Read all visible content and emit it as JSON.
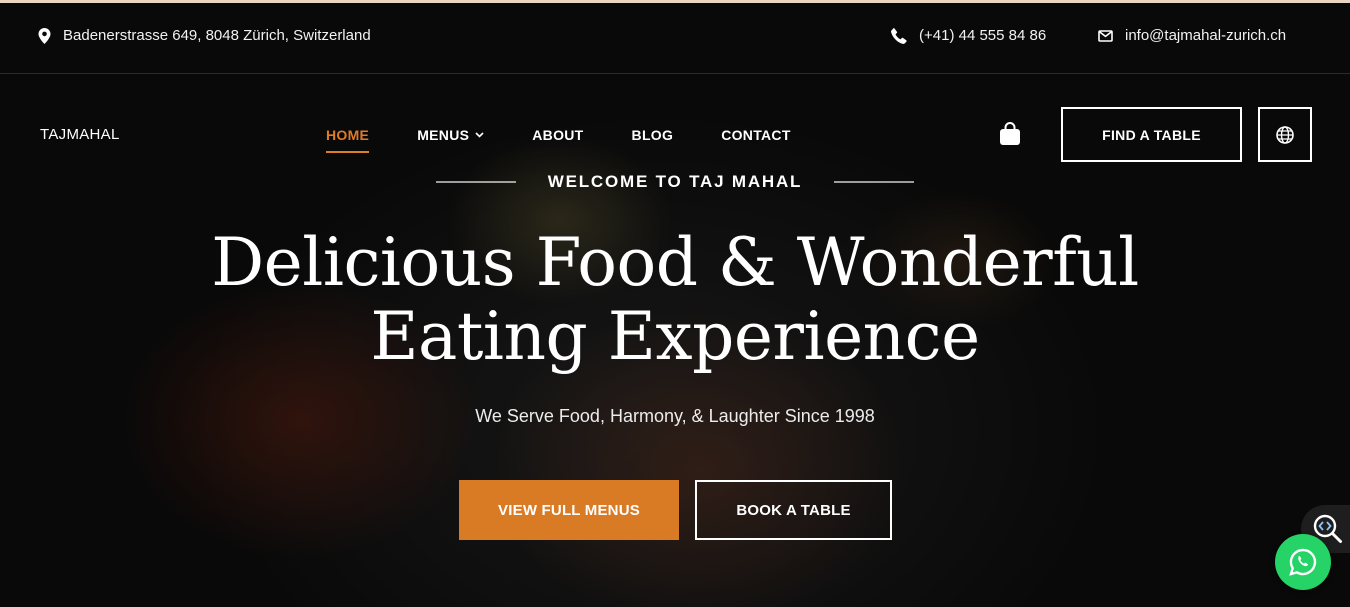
{
  "topbar": {
    "address": "Badenerstrasse 649, 8048 Zürich, Switzerland",
    "phone": "(+41) 44 555 84 86",
    "email": "info@tajmahal-zurich.ch"
  },
  "nav": {
    "logo": "TAJMAHAL",
    "items": [
      {
        "label": "HOME",
        "active": true
      },
      {
        "label": "MENUS",
        "dropdown": true
      },
      {
        "label": "ABOUT"
      },
      {
        "label": "BLOG"
      },
      {
        "label": "CONTACT"
      }
    ],
    "find_table": "FIND A TABLE",
    "icons": {
      "cart": "shopping-bag-icon",
      "language": "globe-icon"
    }
  },
  "hero": {
    "welcome": "WELCOME TO TAJ MAHAL",
    "headline_line1": "Delicious Food & Wonderful",
    "headline_line2": "Eating Experience",
    "tagline": "We Serve Food, Harmony, & Laughter Since 1998",
    "primary_button": "VIEW FULL MENUS",
    "secondary_button": "BOOK A TABLE"
  },
  "widgets": {
    "code": "code-search-icon",
    "chat": "whatsapp-icon"
  },
  "colors": {
    "accent": "#d97a24",
    "whatsapp": "#25d366"
  }
}
